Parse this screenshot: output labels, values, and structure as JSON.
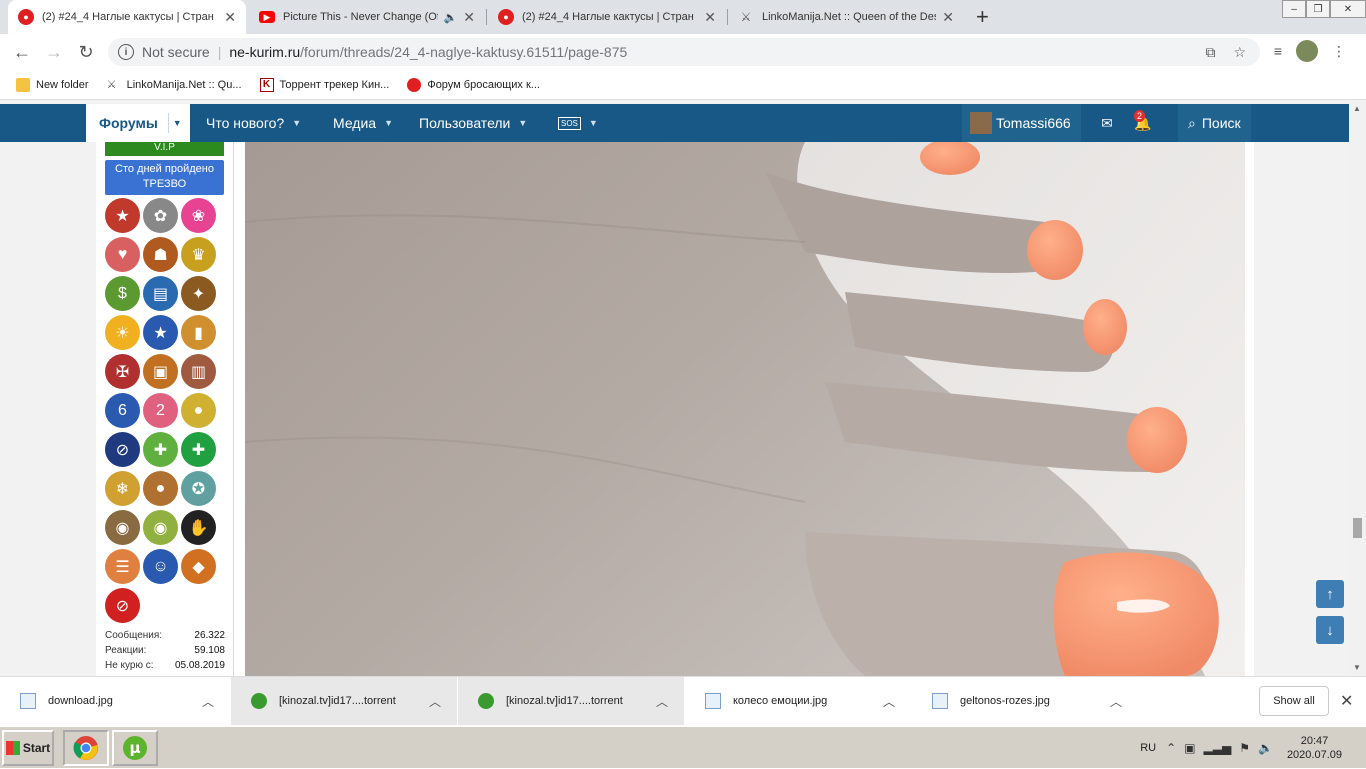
{
  "browser": {
    "tabs": [
      {
        "title": "(2) #24_4 Наглые кактусы | Стран",
        "icon": "forum-favicon",
        "color": "#e02020",
        "active": true
      },
      {
        "title": "Picture This - Never Change (Of",
        "icon": "youtube-favicon",
        "color": "#ff0000",
        "active": false
      },
      {
        "title": "(2) #24_4 Наглые кактусы | Стран",
        "icon": "forum-favicon",
        "color": "#e02020",
        "active": false
      },
      {
        "title": "LinkoManija.Net :: Queen of the Des",
        "icon": "linkomanija-favicon",
        "color": "#777777",
        "active": false
      }
    ],
    "new_tab": "+",
    "address": {
      "security": "Not secure",
      "host": "ne-kurim.ru",
      "path": "/forum/threads/24_4-naglye-kaktusy.61511/page-875"
    },
    "bookmarks": [
      {
        "label": "New folder",
        "icon": "folder-icon"
      },
      {
        "label": "LinkoManija.Net :: Qu...",
        "icon": "linkomanija-icon"
      },
      {
        "label": "Торрент трекер Кин...",
        "icon": "kinozal-icon"
      },
      {
        "label": "Форум бросающих к...",
        "icon": "forum-icon"
      }
    ]
  },
  "forum_nav": {
    "items": [
      {
        "label": "Форумы"
      },
      {
        "label": "Что нового?"
      },
      {
        "label": "Медиа"
      },
      {
        "label": "Пользователи"
      },
      {
        "label": "SOS"
      }
    ],
    "username": "Tomassi666",
    "alerts_count": "2",
    "search_label": "Поиск"
  },
  "sidebar": {
    "vip_label": "V.I.P",
    "sober_banner": "Сто дней пройдено ТРЕЗВО",
    "trophies": [
      {
        "icon": "medal-icon",
        "color": "#c0392b"
      },
      {
        "icon": "puzzle-icon",
        "color": "#888888"
      },
      {
        "icon": "color-wheel-icon",
        "color": "#e84393"
      },
      {
        "icon": "teddy-bear-icon",
        "color": "#d96060"
      },
      {
        "icon": "no-smoking-3-icon",
        "color": "#b05a20"
      },
      {
        "icon": "trophy-cup-icon",
        "color": "#c8a020"
      },
      {
        "icon": "money-bag-icon",
        "color": "#5a9a30"
      },
      {
        "icon": "book-icon",
        "color": "#2a6ab0"
      },
      {
        "icon": "star-award-icon",
        "color": "#8a5a20"
      },
      {
        "icon": "sun-icon",
        "color": "#f0b020"
      },
      {
        "icon": "blue-star-icon",
        "color": "#2a5ab0"
      },
      {
        "icon": "beer-icon",
        "color": "#d09030"
      },
      {
        "icon": "knight-icon",
        "color": "#b03030"
      },
      {
        "icon": "treasure-chest-icon",
        "color": "#c07020"
      },
      {
        "icon": "suitcase-icon",
        "color": "#a05a40"
      },
      {
        "icon": "award-6-icon",
        "color": "#2a5ab0"
      },
      {
        "icon": "number-2-icon",
        "color": "#e06080"
      },
      {
        "icon": "gold-medal-icon",
        "color": "#d0b030"
      },
      {
        "icon": "no-alcohol-6-icon",
        "color": "#203a80"
      },
      {
        "icon": "healthy-life-icon",
        "color": "#60b040"
      },
      {
        "icon": "first-aid-icon",
        "color": "#20a040"
      },
      {
        "icon": "snowflake-icon",
        "color": "#d0a030"
      },
      {
        "icon": "cookie-icon",
        "color": "#b07030"
      },
      {
        "icon": "ribbon-3-icon",
        "color": "#60a0a0"
      },
      {
        "icon": "owl-icon",
        "color": "#8a6a40"
      },
      {
        "icon": "owl-green-icon",
        "color": "#90b040"
      },
      {
        "icon": "hi-hand-icon",
        "color": "#222222"
      },
      {
        "icon": "reading-icon",
        "color": "#e08040"
      },
      {
        "icon": "people-icon",
        "color": "#2a5ab0"
      },
      {
        "icon": "tiger-icon",
        "color": "#d07020"
      },
      {
        "icon": "no-drinking-icon",
        "color": "#d02020"
      }
    ],
    "stats": [
      {
        "label": "Сообщения:",
        "value": "26.322"
      },
      {
        "label": "Реакции:",
        "value": "59.108"
      },
      {
        "label": "Не курю с:",
        "value": "05.08.2019"
      }
    ]
  },
  "downloads": {
    "items": [
      {
        "name": "download.jpg",
        "icon": "image-file-icon"
      },
      {
        "name": "[kinozal.tv]id17....torrent",
        "icon": "torrent-file-icon"
      },
      {
        "name": "[kinozal.tv]id17....torrent",
        "icon": "torrent-file-icon"
      },
      {
        "name": "колесо емоции.jpg",
        "icon": "image-file-icon"
      },
      {
        "name": "geltonos-rozes.jpg",
        "icon": "image-file-icon"
      }
    ],
    "show_all": "Show all"
  },
  "taskbar": {
    "start": "Start",
    "language": "RU",
    "time": "20:47",
    "date": "2020.07.09"
  }
}
